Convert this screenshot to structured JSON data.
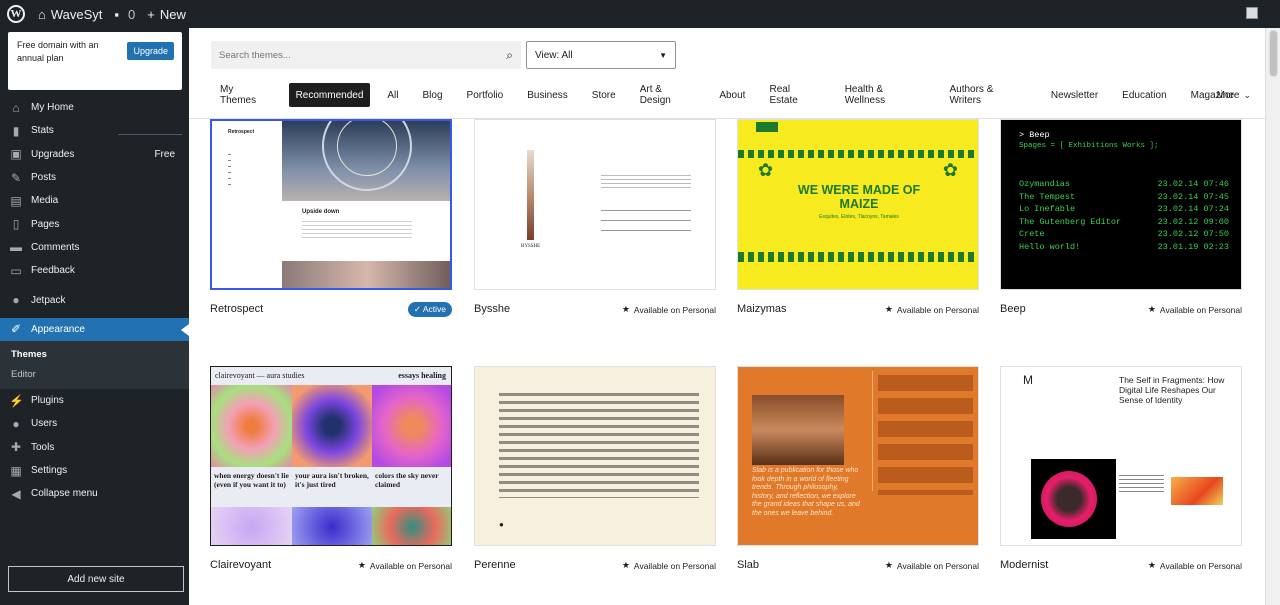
{
  "adminbar": {
    "site_name": "WaveSyt",
    "comments_count": "0",
    "new_label": "New"
  },
  "promo": {
    "text": "Free domain with an annual plan",
    "button": "Upgrade"
  },
  "sidebar": {
    "items": [
      {
        "label": "My Home",
        "icon": "home-icon"
      },
      {
        "label": "Stats",
        "icon": "stats-icon"
      },
      {
        "label": "Upgrades",
        "icon": "cart-icon",
        "badge": "Free"
      },
      {
        "label": "Posts",
        "icon": "pin-icon"
      },
      {
        "label": "Media",
        "icon": "media-icon"
      },
      {
        "label": "Pages",
        "icon": "pages-icon"
      },
      {
        "label": "Comments",
        "icon": "comment-icon"
      },
      {
        "label": "Feedback",
        "icon": "feedback-icon"
      },
      {
        "label": "Jetpack",
        "icon": "jetpack-icon"
      },
      {
        "label": "Appearance",
        "icon": "brush-icon"
      },
      {
        "label": "Plugins",
        "icon": "plug-icon"
      },
      {
        "label": "Users",
        "icon": "users-icon"
      },
      {
        "label": "Tools",
        "icon": "wrench-icon"
      },
      {
        "label": "Settings",
        "icon": "settings-icon"
      },
      {
        "label": "Collapse menu",
        "icon": "collapse-icon"
      }
    ],
    "submenu": [
      {
        "label": "Themes"
      },
      {
        "label": "Editor"
      }
    ],
    "add_site": "Add new site"
  },
  "search": {
    "placeholder": "Search themes..."
  },
  "view_select": {
    "value": "View: All"
  },
  "tabs": [
    {
      "label": "My Themes"
    },
    {
      "label": "Recommended"
    },
    {
      "label": "All"
    },
    {
      "label": "Blog"
    },
    {
      "label": "Portfolio"
    },
    {
      "label": "Business"
    },
    {
      "label": "Store"
    },
    {
      "label": "Art & Design"
    },
    {
      "label": "About"
    },
    {
      "label": "Real Estate"
    },
    {
      "label": "Health & Wellness"
    },
    {
      "label": "Authors & Writers"
    },
    {
      "label": "Newsletter"
    },
    {
      "label": "Education"
    },
    {
      "label": "Magazine"
    }
  ],
  "more_label": "More",
  "themes": [
    {
      "name": "Retrospect",
      "status": "Active"
    },
    {
      "name": "Bysshe",
      "status": "Available on Personal"
    },
    {
      "name": "Maizymas",
      "status": "Available on Personal"
    },
    {
      "name": "Beep",
      "status": "Available on Personal"
    },
    {
      "name": "Clairevoyant",
      "status": "Available on Personal"
    },
    {
      "name": "Perenne",
      "status": "Available on Personal"
    },
    {
      "name": "Slab",
      "status": "Available on Personal"
    },
    {
      "name": "Modernist",
      "status": "Available on Personal"
    }
  ],
  "previews": {
    "retrospect": {
      "heading": "Upside down",
      "title": "Retrospect"
    },
    "bysshe": {
      "caption": "BYSSHE"
    },
    "maize": {
      "headline": "WE WERE MADE OF MAIZE",
      "sub": "Esquites, Elotes, Tlacoyos, Tamales"
    },
    "beep": {
      "title": "> Beep",
      "nav": "Spages = [ Exhibitions Works ];",
      "rows": [
        {
          "t": "Ozymandias",
          "d": "23.02.14 07:46"
        },
        {
          "t": "The Tempest",
          "d": "23.02.14 07:45"
        },
        {
          "t": "Lo Inefable",
          "d": "23.02.14 07:24"
        },
        {
          "t": "The Gutenberg Editor",
          "d": "23.02.12 09:00"
        },
        {
          "t": "Crete",
          "d": "23.02.12 07:50"
        },
        {
          "t": "Hello world!",
          "d": "23.01.19 02:23"
        }
      ]
    },
    "clair": {
      "brand": "clairevoyant — aura studies",
      "nav": "essays  healing",
      "c1": "when energy doesn't lie (even if you want it to)",
      "c2": "your aura isn't broken, it's just tired",
      "c3": "colors the sky never claimed"
    },
    "slab": {
      "text": "Slab is a publication for those who look depth in a world of fleeting trends. Through philosophy, history, and reflection, we explore the grand ideas that shape us, and the ones we leave behind."
    },
    "modern": {
      "logo": "M",
      "headline": "The Self in Fragments: How Digital Life Reshapes Our Sense of Identity"
    }
  },
  "colors": {
    "accent": "#2271b1",
    "sidebar_bg": "#1d2327",
    "maize_yellow": "#f7ea1e",
    "slab_orange": "#e07a2a"
  }
}
